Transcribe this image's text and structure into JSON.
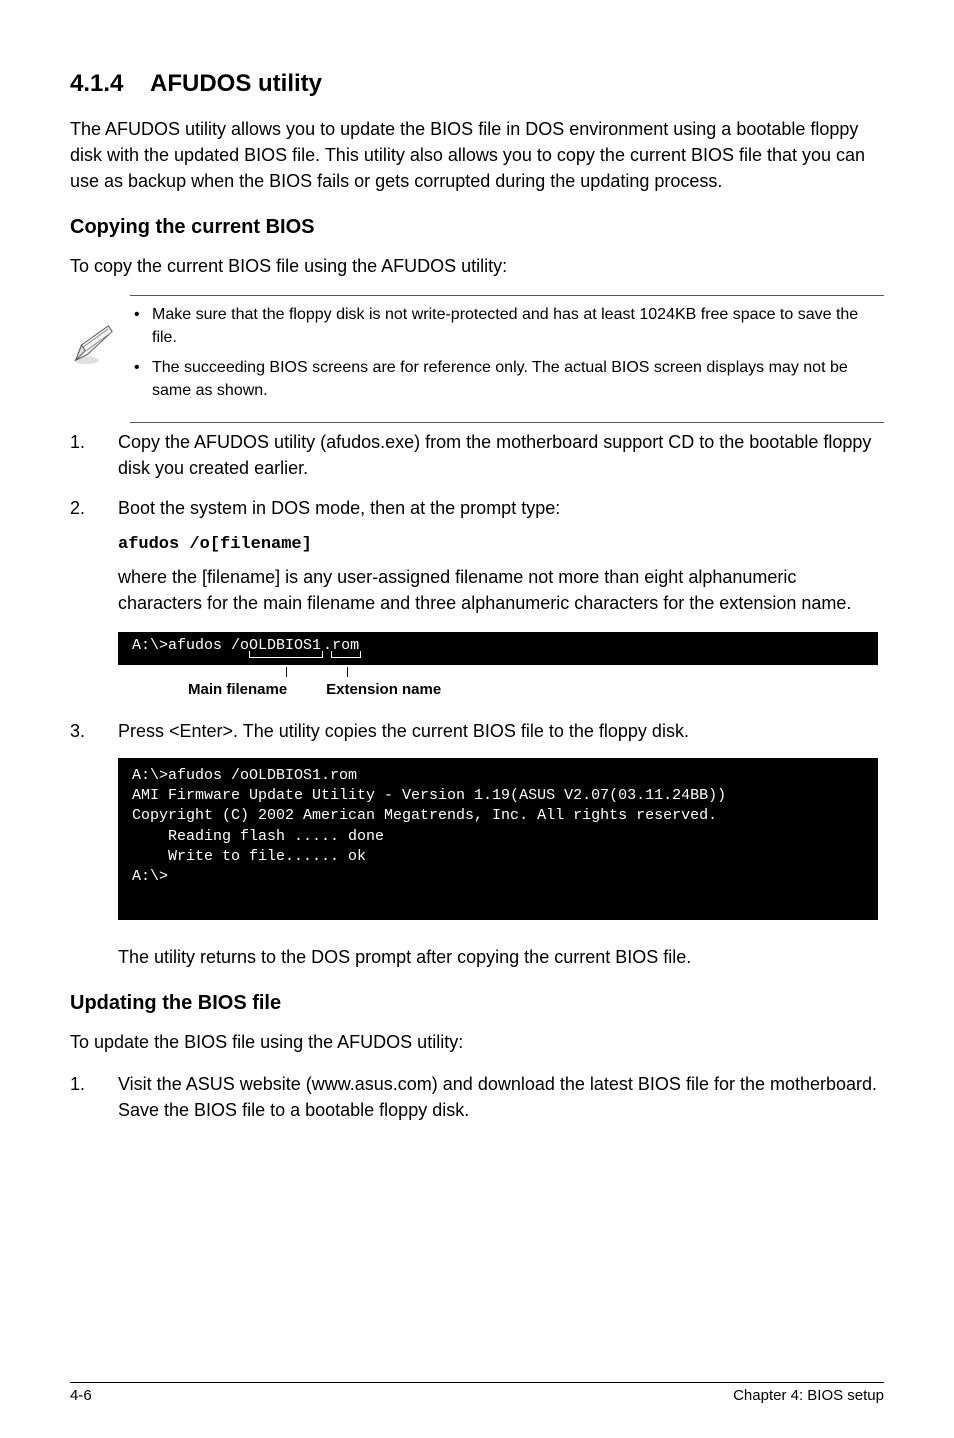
{
  "section": {
    "number": "4.1.4",
    "title": "AFUDOS utility",
    "intro": "The AFUDOS utility allows you to update the BIOS file in DOS environment using a bootable floppy disk with the updated BIOS file. This utility also allows you to copy the current BIOS file that you can use as backup when the BIOS fails or gets corrupted during the updating process."
  },
  "copying": {
    "heading": "Copying the current BIOS",
    "intro": "To copy the current BIOS file using the AFUDOS utility:",
    "notes": [
      "Make sure that the floppy disk is not write-protected and has at least 1024KB free space to save the file.",
      "The succeeding BIOS screens are for reference only. The actual BIOS screen displays may not be same as shown."
    ],
    "steps": [
      {
        "n": "1.",
        "text": "Copy the AFUDOS utility (afudos.exe) from the motherboard support CD to the bootable floppy disk you created earlier."
      },
      {
        "n": "2.",
        "text": "Boot the system in DOS mode, then at the prompt type:"
      }
    ],
    "command": "afudos /o[filename]",
    "explain": "where the [filename] is any user-assigned filename not more than eight alphanumeric characters  for the main filename and three alphanumeric characters for the extension name.",
    "terminal1": "A:\\>afudos /oOLDBIOS1.rom",
    "labels": {
      "main": "Main filename",
      "ext": "Extension name"
    },
    "step3": {
      "n": "3.",
      "text": "Press <Enter>. The utility copies the current BIOS file to the floppy disk."
    },
    "terminal2": "A:\\>afudos /oOLDBIOS1.rom\nAMI Firmware Update Utility - Version 1.19(ASUS V2.07(03.11.24BB))\nCopyright (C) 2002 American Megatrends, Inc. All rights reserved.\n    Reading flash ..... done\n    Write to file...... ok\nA:\\>\n ",
    "after": "The utility returns to the DOS prompt after copying the current BIOS file."
  },
  "updating": {
    "heading": "Updating the BIOS file",
    "intro": "To update the BIOS file using the AFUDOS utility:",
    "steps": [
      {
        "n": "1.",
        "text": "Visit the ASUS website (www.asus.com) and download the latest BIOS file for the motherboard. Save the BIOS file to a bootable floppy disk."
      }
    ]
  },
  "footer": {
    "page": "4-6",
    "chapter": "Chapter 4: BIOS setup"
  }
}
